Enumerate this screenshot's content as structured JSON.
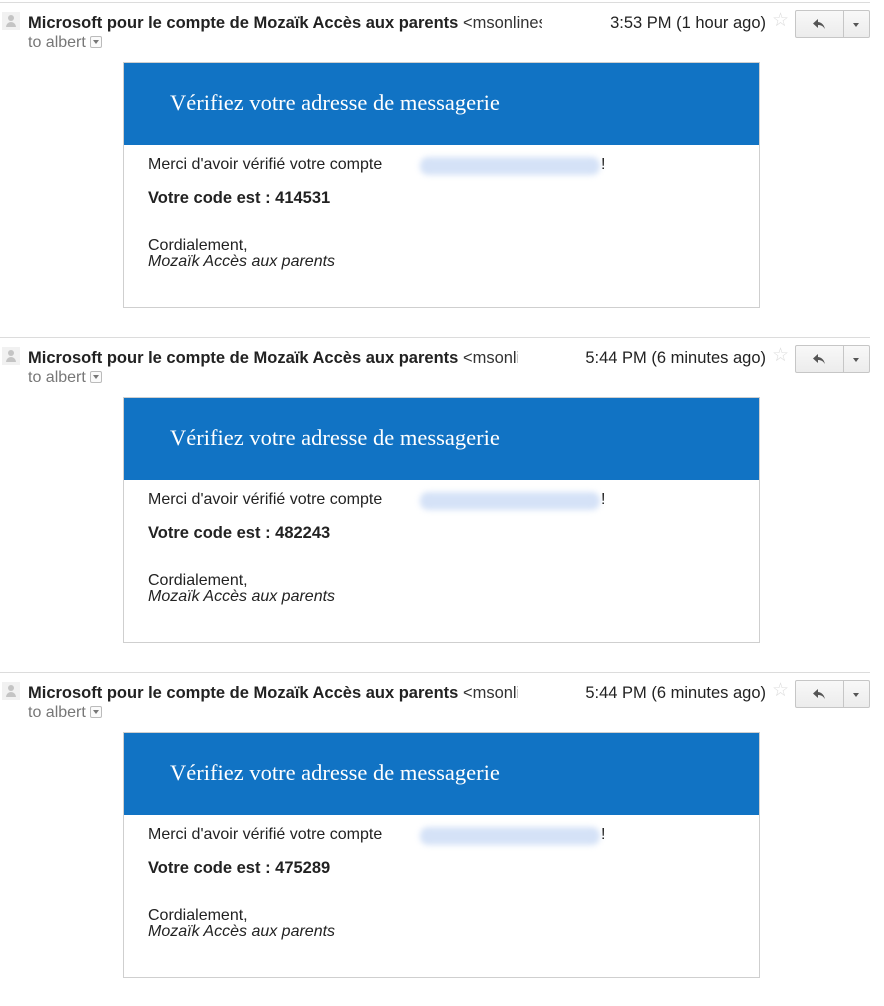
{
  "messages": [
    {
      "sender_name": "Microsoft pour le compte de Mozaïk Accès aux parents",
      "sender_addr": "<msonlineservicesteam",
      "time": "3:53 PM (1 hour ago)",
      "recipient": "to albert",
      "banner_title": "Vérifiez votre adresse de messagerie",
      "thanks_text": "Merci d'avoir vérifié votre compte",
      "thanks_end": "!",
      "code_text": "Votre code est : 414531",
      "regards": "Cordialement,",
      "signature": "Mozaïk Accès aux parents"
    },
    {
      "sender_name": "Microsoft pour le compte de Mozaïk Accès aux parents",
      "sender_addr": "<msonlineservicesteam",
      "time": "5:44 PM (6 minutes ago)",
      "recipient": "to albert",
      "banner_title": "Vérifiez votre adresse de messagerie",
      "thanks_text": "Merci d'avoir vérifié votre compte",
      "thanks_end": "!",
      "code_text": "Votre code est : 482243",
      "regards": "Cordialement,",
      "signature": "Mozaïk Accès aux parents"
    },
    {
      "sender_name": "Microsoft pour le compte de Mozaïk Accès aux parents",
      "sender_addr": "<msonlineservicesteam",
      "time": "5:44 PM (6 minutes ago)",
      "recipient": "to albert",
      "banner_title": "Vérifiez votre adresse de messagerie",
      "thanks_text": "Merci d'avoir vérifié votre compte",
      "thanks_end": "!",
      "code_text": "Votre code est : 475289",
      "regards": "Cordialement,",
      "signature": "Mozaïk Accès aux parents"
    }
  ],
  "icons": {
    "avatar": "default-avatar-icon",
    "star": "star-icon",
    "reply": "reply-icon",
    "more": "chevron-down-icon"
  },
  "colors": {
    "banner": "#1173c4",
    "star": "#dcdcdc"
  }
}
